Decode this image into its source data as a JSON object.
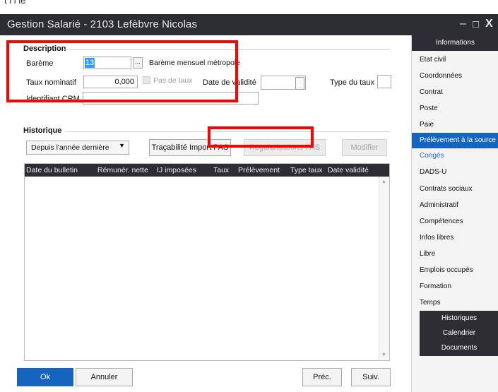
{
  "window": {
    "top_strip_text": "t  l   l   ié",
    "title": "Gestion Salarié - 2103 Lefèbvre Nicolas",
    "controls": {
      "minimize": "–",
      "maximize": "□",
      "close": "X"
    }
  },
  "description": {
    "section": "Description",
    "bareme_label": "Barème",
    "bareme_value": "13",
    "bareme_browse": "...",
    "bareme_text": "Barème mensuel métropole",
    "taux_label": "Taux nominatif",
    "taux_value": "0,000",
    "pas_de_taux_label": "Pas de taux",
    "date_validite_label": "Date de validité",
    "date_validite_value": "",
    "type_taux_label": "Type du taux",
    "type_taux_value": "",
    "identifiant_label": "Identifiant CRM",
    "identifiant_value": ""
  },
  "historique": {
    "section": "Historique",
    "period_select": "Depuis l'année dernière",
    "trace_button": "Traçabilité Import PAS",
    "regul_button": "Régularisations PAS",
    "modify_button": "Modifier",
    "columns": [
      "Date du bulletin",
      "Rémunér. nette",
      "IJ imposées",
      "Taux",
      "Prélèvement",
      "Type taux",
      "Date validité"
    ]
  },
  "footer": {
    "ok": "Ok",
    "cancel": "Annuler",
    "prev": "Préc.",
    "next": "Suiv."
  },
  "sidebar": {
    "header": "Informations",
    "items": [
      "Etat civil",
      "Coordonnées",
      "Contrat",
      "Poste",
      "Paie",
      "Prélèvement à la source",
      "Congés",
      "DADS-U",
      "Contrats sociaux",
      "Administratif",
      "Compétences",
      "Infos libres",
      "Libre",
      "Emplois occupés",
      "Formation",
      "Temps"
    ],
    "sub_items": [
      "Historiques",
      "Calendrier",
      "Documents"
    ]
  },
  "colors": {
    "titlebar": "#2c2c33",
    "accent": "#1565c0",
    "highlight": "#ff0000"
  }
}
